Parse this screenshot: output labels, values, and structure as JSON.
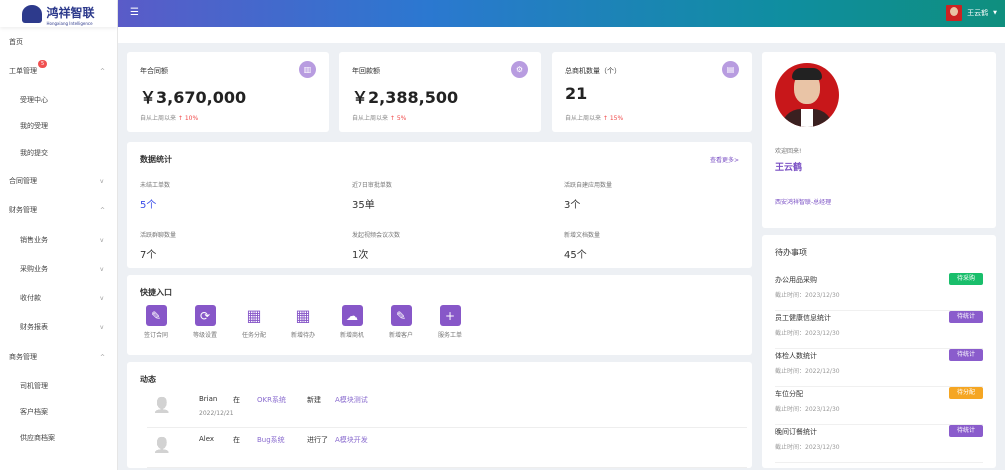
{
  "brand": {
    "name": "鸿祥智联",
    "sub": "Hongxiang Intelligence"
  },
  "header": {
    "user": "王云鹤"
  },
  "sidebar": [
    {
      "label": "首页",
      "sub": false,
      "chev": ""
    },
    {
      "label": "工单管理",
      "sub": false,
      "chev": "^",
      "badge": "5"
    },
    {
      "label": "受理中心",
      "sub": true,
      "chev": ""
    },
    {
      "label": "我的受理",
      "sub": true,
      "chev": ""
    },
    {
      "label": "我的提交",
      "sub": true,
      "chev": ""
    },
    {
      "label": "合同管理",
      "sub": false,
      "chev": "v"
    },
    {
      "label": "财务管理",
      "sub": false,
      "chev": "^"
    },
    {
      "label": "销售业务",
      "sub": true,
      "chev": "v"
    },
    {
      "label": "采购业务",
      "sub": true,
      "chev": "v"
    },
    {
      "label": "收付款",
      "sub": true,
      "chev": "v"
    },
    {
      "label": "财务报表",
      "sub": true,
      "chev": "v"
    },
    {
      "label": "商务管理",
      "sub": false,
      "chev": "^"
    },
    {
      "label": "司机管理",
      "sub": true,
      "chev": ""
    },
    {
      "label": "客户档案",
      "sub": true,
      "chev": ""
    },
    {
      "label": "供应商档案",
      "sub": true,
      "chev": ""
    }
  ],
  "kpis": [
    {
      "title": "年合同额",
      "value": "￥3,670,000",
      "foot": "自从上周以来",
      "change": "10%",
      "icon": "bar-chart-icon"
    },
    {
      "title": "年回款额",
      "value": "￥2,388,500",
      "foot": "自从上周以来",
      "change": "5%",
      "icon": "gear-icon"
    },
    {
      "title": "总商机数量（个）",
      "value": "21",
      "foot": "自从上周以来",
      "change": "15%",
      "icon": "document-icon"
    }
  ],
  "stats": {
    "title": "数据统计",
    "more": "查看更多>",
    "items": [
      {
        "label": "未结工单数",
        "value": "5个"
      },
      {
        "label": "近7日审批单数",
        "value": "35单"
      },
      {
        "label": "活跃自建应用数量",
        "value": "3个"
      },
      {
        "label": "活跃群聊数量",
        "value": "7个"
      },
      {
        "label": "发起视频会议次数",
        "value": "1次"
      },
      {
        "label": "新增文档数量",
        "value": "45个"
      }
    ]
  },
  "quick": {
    "title": "快捷入口",
    "items": [
      {
        "label": "签订合同",
        "glyph": "✎"
      },
      {
        "label": "等级设置",
        "glyph": "⟳"
      },
      {
        "label": "任务分配",
        "glyph": "▦"
      },
      {
        "label": "新增待办",
        "glyph": "▦"
      },
      {
        "label": "新增商机",
        "glyph": "☁"
      },
      {
        "label": "新增客户",
        "glyph": "✎"
      },
      {
        "label": "服务工单",
        "glyph": "+"
      }
    ]
  },
  "dynamics": {
    "title": "动态",
    "items": [
      {
        "user": "Brian",
        "at": "在",
        "system": "OKR系统",
        "action": "新建",
        "target": "A模块测试",
        "date": "2022/12/21"
      },
      {
        "user": "Alex",
        "at": "在",
        "system": "Bug系统",
        "action": "进行了",
        "target": "A模块开发",
        "date": ""
      }
    ]
  },
  "profile": {
    "welcome": "欢迎回来!",
    "name": "王云鹤",
    "org": "西安鸿祥智联-总经理"
  },
  "todo": {
    "title": "待办事项",
    "items": [
      {
        "title": "办公用品采购",
        "deadline": "截止时间：2023/12/30",
        "tag": "待采购",
        "color": "#19be6b"
      },
      {
        "title": "员工健康信息统计",
        "deadline": "截止时间：2023/12/30",
        "tag": "待统计",
        "color": "#8a5ccc"
      },
      {
        "title": "体检人数统计",
        "deadline": "截止时间：2022/12/30",
        "tag": "待统计",
        "color": "#8a5ccc"
      },
      {
        "title": "车位分配",
        "deadline": "截止时间：2023/12/30",
        "tag": "待分配",
        "color": "#f5a623"
      },
      {
        "title": "晚间订餐统计",
        "deadline": "截止时间：2023/12/30",
        "tag": "待统计",
        "color": "#8a5ccc"
      }
    ]
  }
}
